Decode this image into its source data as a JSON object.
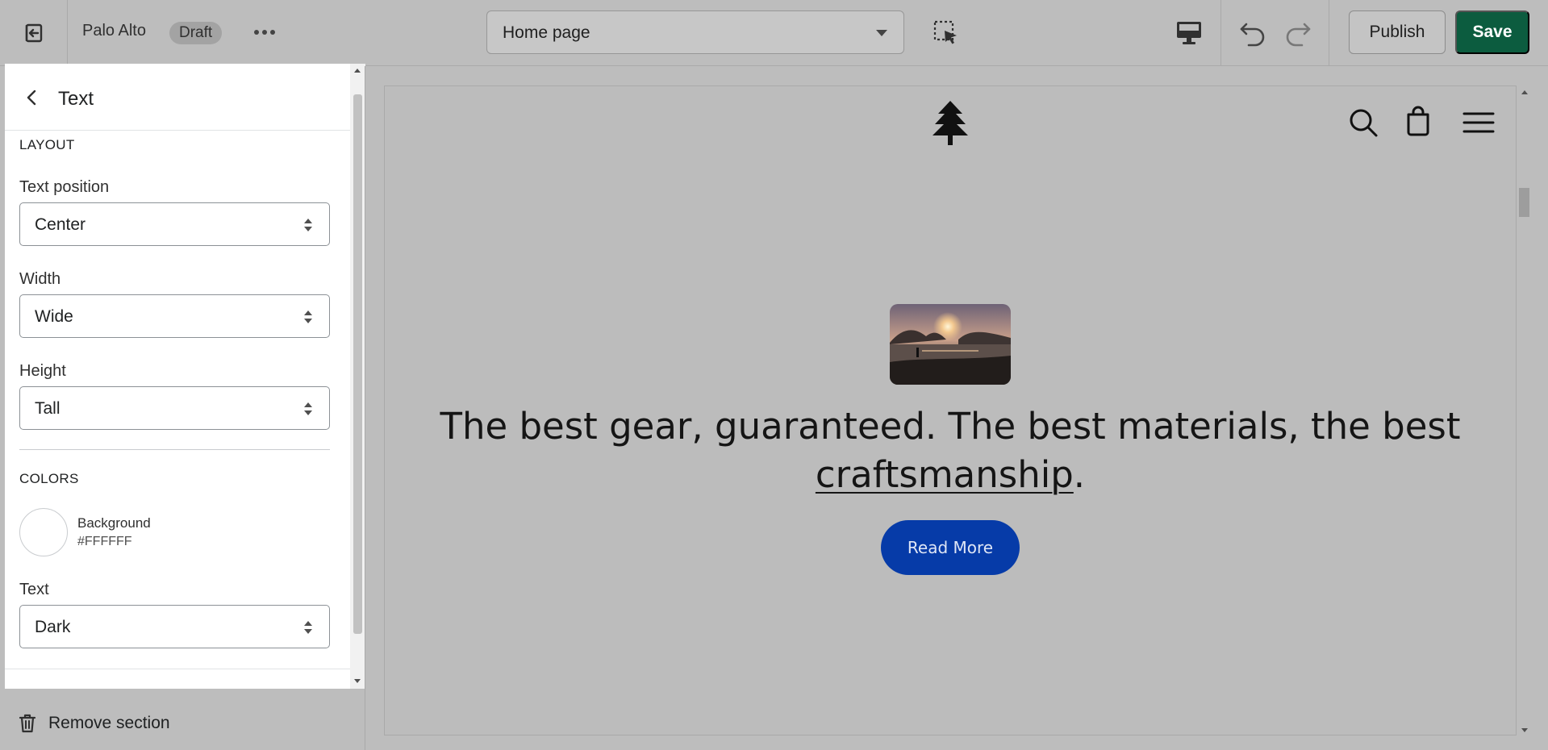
{
  "topbar": {
    "store_name": "Palo Alto",
    "status_badge": "Draft",
    "page_selector": "Home page",
    "publish_label": "Publish",
    "save_label": "Save"
  },
  "panel": {
    "title": "Text",
    "layout": {
      "heading": "LAYOUT",
      "text_position": {
        "label": "Text position",
        "value": "Center"
      },
      "width": {
        "label": "Width",
        "value": "Wide"
      },
      "height": {
        "label": "Height",
        "value": "Tall"
      }
    },
    "colors": {
      "heading": "COLORS",
      "background": {
        "label": "Background",
        "value": "#FFFFFF"
      },
      "text": {
        "label": "Text",
        "value": "Dark"
      }
    },
    "remove_label": "Remove section"
  },
  "preview": {
    "headline_main": "The best gear, guaranteed. The best materials, the best",
    "headline_link": "craftsmanship",
    "headline_end": ".",
    "cta_label": "Read More"
  },
  "colors": {
    "save_button": "#0c5c3f",
    "cta_button": "#063ba8"
  }
}
